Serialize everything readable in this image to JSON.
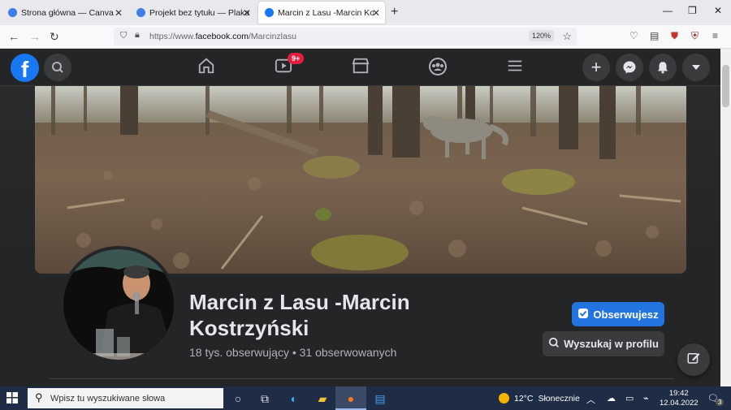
{
  "browser": {
    "tabs": [
      {
        "title": "Strona główna — Canva",
        "favicon_color": "#3f7ee8"
      },
      {
        "title": "Projekt bez tytułu — Plakat",
        "favicon_color": "#3f7ee8"
      },
      {
        "title": "Marcin z Lasu -Marcin Kostrzyński",
        "favicon_color": "#1877f2"
      }
    ],
    "url_prefix": "https://www.",
    "url_domain": "facebook.com",
    "url_path": "/Marcinzlasu",
    "zoom": "120%"
  },
  "facebook": {
    "logo": "f",
    "notif_badge": "9+",
    "nav_icons": [
      "home-icon",
      "watch-icon",
      "marketplace-icon",
      "groups-icon",
      "menu-icon"
    ],
    "right_icons": [
      "plus-icon",
      "messenger-icon",
      "bell-icon",
      "caret-down-icon"
    ],
    "profile": {
      "name": "Marcin z Lasu -Marcin Kostrzyński",
      "stats": "18 tys. obserwujący • 31 obserwowanych",
      "follow_label": "Obserwujesz",
      "search_label": "Wyszukaj w profilu"
    },
    "accent": "#2374e1"
  },
  "taskbar": {
    "search_placeholder": "Wpisz tu wyszukiwane słowa",
    "weather_temp": "12°C",
    "weather_text": "Słonecznie",
    "time": "19:42",
    "date": "12.04.2022",
    "notification_count": "3"
  }
}
